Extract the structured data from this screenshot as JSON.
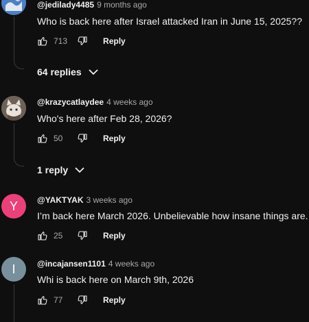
{
  "comments": [
    {
      "handle": "@jedilady4485",
      "time": "9 months ago",
      "text": "Who is back here after Israel attacked Iran in June 15, 2025??",
      "likes": "713",
      "reply_label": "Reply",
      "replies_label": "64 replies",
      "avatar_color": "#3f6fb0"
    },
    {
      "handle": "@krazycatlaydee",
      "time": "4 weeks ago",
      "text": "Who's here after Feb 28, 2026?",
      "likes": "50",
      "reply_label": "Reply",
      "replies_label": "1 reply",
      "avatar_color": "#7b6a5c"
    },
    {
      "handle": "@YAKTYAK",
      "time": "3 weeks ago",
      "text": "I’m back here March 2026. Unbelievable how insane things are.",
      "likes": "25",
      "reply_label": "Reply",
      "avatar_letter": "Y",
      "avatar_color": "#ec407a"
    },
    {
      "handle": "@incajansen1101",
      "time": "4 weeks ago",
      "text": "Whi is back here on March 9th, 2026",
      "likes": "77",
      "reply_label": "Reply",
      "avatar_letter": "I",
      "avatar_color": "#78909c"
    }
  ]
}
